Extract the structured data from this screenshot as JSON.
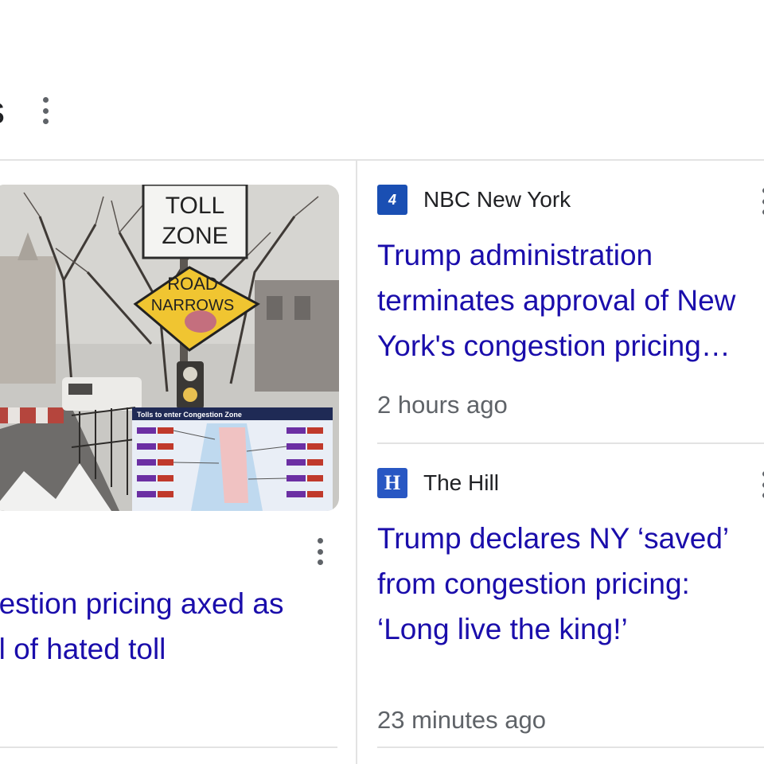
{
  "header": {
    "title": "s"
  },
  "left_card": {
    "sign_top_line1": "TOLL",
    "sign_top_line2": "ZONE",
    "sign_diamond_line1": "ROAD",
    "sign_diamond_line2": "NARROWS",
    "map_title": "Tolls to enter Congestion Zone",
    "headline_line1": "gestion pricing axed as",
    "headline_line2": "al of hated toll"
  },
  "stories": [
    {
      "source_logo_text": "4",
      "source": "NBC New York",
      "title": "Trump administration terminates approval of New York's congestion pricing…",
      "time": "2 hours ago"
    },
    {
      "source_logo_text": "H",
      "source": "The Hill",
      "title": "Trump declares NY ‘saved’ from congestion pricing: ‘Long live the king!’",
      "time": "23 minutes ago"
    }
  ],
  "colors": {
    "link": "#1a0dab",
    "nbc_logo": "#1a4fb3",
    "hill_logo": "#2857c3",
    "divider": "#e3e3e3"
  }
}
